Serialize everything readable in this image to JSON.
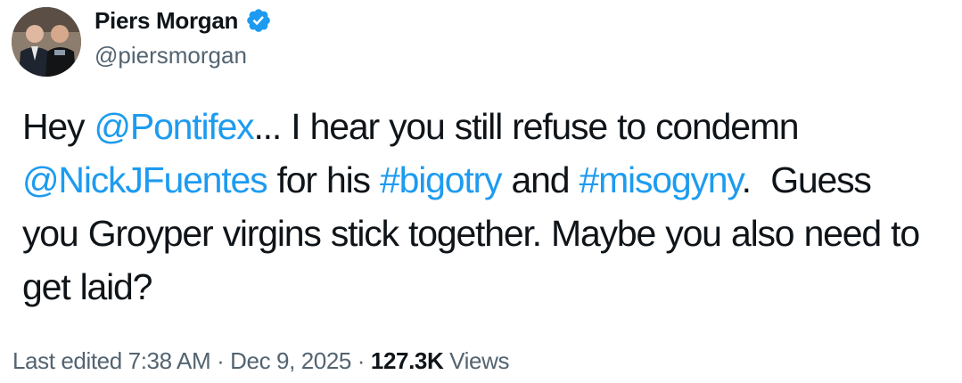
{
  "author": {
    "display_name": "Piers Morgan",
    "handle": "@piersmorgan",
    "verified": true,
    "verified_color": "#1d9bf0"
  },
  "tweet": {
    "segments": [
      {
        "text": "Hey ",
        "type": "text"
      },
      {
        "text": "@Pontifex",
        "type": "mention"
      },
      {
        "text": "... I hear you still refuse to condemn ",
        "type": "text"
      },
      {
        "text": "@NickJFuentes",
        "type": "mention"
      },
      {
        "text": " for his ",
        "type": "text"
      },
      {
        "text": "#bigotry",
        "type": "hashtag"
      },
      {
        "text": " and ",
        "type": "text"
      },
      {
        "text": "#misogyny",
        "type": "hashtag"
      },
      {
        "text": ".  Guess you Groyper virgins stick together. Maybe you also need to get laid?",
        "type": "text"
      }
    ]
  },
  "meta": {
    "edited_label": "Last edited",
    "time": "7:38 AM",
    "separator": "·",
    "date": "Dec 9, 2025",
    "views_count": "127.3K",
    "views_label": "Views"
  },
  "colors": {
    "link": "#1d9bf0",
    "text": "#0f1419",
    "secondary": "#536471"
  }
}
